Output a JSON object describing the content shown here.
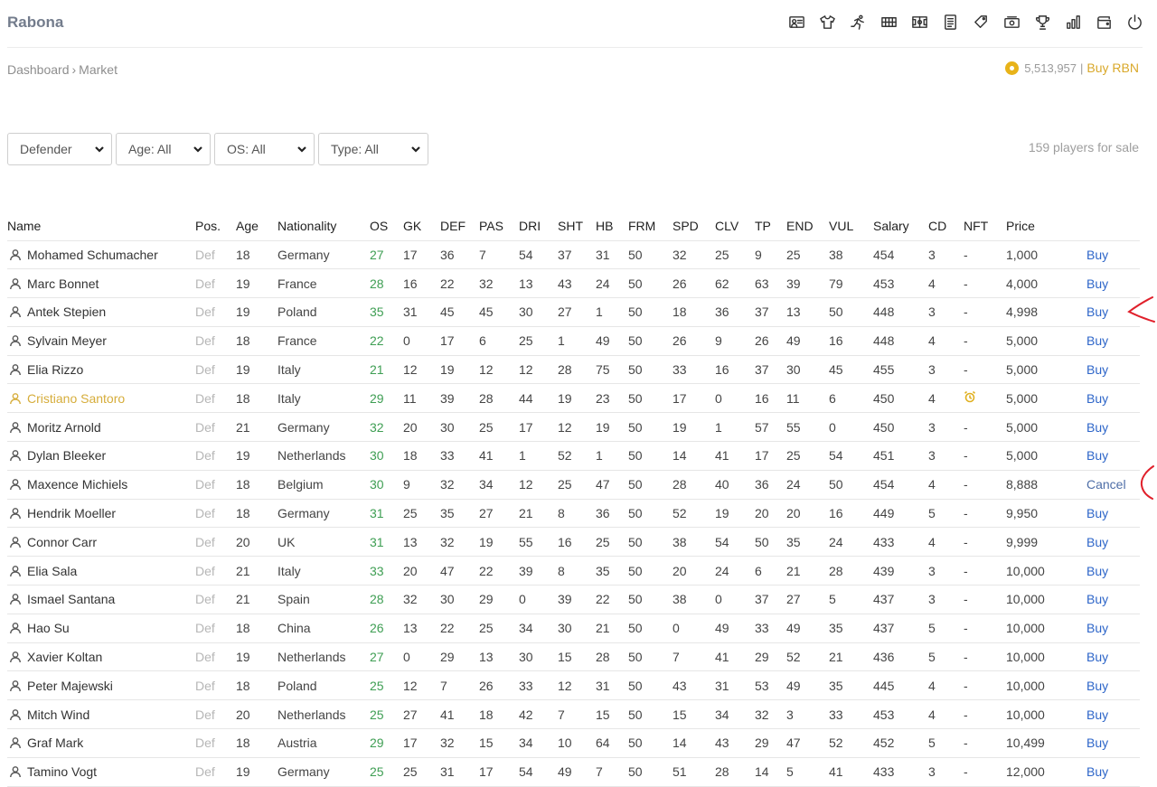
{
  "app": {
    "brand": "Rabona"
  },
  "nav": {
    "icons": [
      "card-icon",
      "shirt-icon",
      "runner-icon",
      "grid-icon",
      "field-icon",
      "document-icon",
      "tag-icon",
      "money-icon",
      "trophy-icon",
      "bar-chart-icon",
      "wallet-icon",
      "power-icon"
    ]
  },
  "breadcrumb": {
    "home": "Dashboard",
    "separator": "›",
    "current": "Market"
  },
  "balance": {
    "amount": "5,513,957",
    "separator": "|",
    "buy_label": "Buy RBN"
  },
  "filters": {
    "position": "Defender",
    "age": "Age: All",
    "os": "OS: All",
    "type": "Type: All"
  },
  "players_for_sale": "159 players for sale",
  "table": {
    "headers": [
      "Name",
      "Pos.",
      "Age",
      "Nationality",
      "OS",
      "GK",
      "DEF",
      "PAS",
      "DRI",
      "SHT",
      "HB",
      "FRM",
      "SPD",
      "CLV",
      "TP",
      "END",
      "VUL",
      "Salary",
      "CD",
      "NFT",
      "Price",
      ""
    ],
    "rows": [
      [
        "Mohamed Schumacher",
        "Def",
        "18",
        "Germany",
        "27",
        "17",
        "36",
        "7",
        "54",
        "37",
        "31",
        "50",
        "32",
        "25",
        "9",
        "25",
        "38",
        "454",
        "3",
        "-",
        "1,000",
        "Buy"
      ],
      [
        "Marc Bonnet",
        "Def",
        "19",
        "France",
        "28",
        "16",
        "22",
        "32",
        "13",
        "43",
        "24",
        "50",
        "26",
        "62",
        "63",
        "39",
        "79",
        "453",
        "4",
        "-",
        "4,000",
        "Buy"
      ],
      [
        "Antek Stepien",
        "Def",
        "19",
        "Poland",
        "35",
        "31",
        "45",
        "45",
        "30",
        "27",
        "1",
        "50",
        "18",
        "36",
        "37",
        "13",
        "50",
        "448",
        "3",
        "-",
        "4,998",
        "Buy"
      ],
      [
        "Sylvain Meyer",
        "Def",
        "18",
        "France",
        "22",
        "0",
        "17",
        "6",
        "25",
        "1",
        "49",
        "50",
        "26",
        "9",
        "26",
        "49",
        "16",
        "448",
        "4",
        "-",
        "5,000",
        "Buy"
      ],
      [
        "Elia Rizzo",
        "Def",
        "19",
        "Italy",
        "21",
        "12",
        "19",
        "12",
        "12",
        "28",
        "75",
        "50",
        "33",
        "16",
        "37",
        "30",
        "45",
        "455",
        "3",
        "-",
        "5,000",
        "Buy"
      ],
      [
        "Cristiano Santoro",
        "Def",
        "18",
        "Italy",
        "29",
        "11",
        "39",
        "28",
        "44",
        "19",
        "23",
        "50",
        "17",
        "0",
        "16",
        "11",
        "6",
        "450",
        "4",
        "",
        "5,000",
        "Buy"
      ],
      [
        "Moritz Arnold",
        "Def",
        "21",
        "Germany",
        "32",
        "20",
        "30",
        "25",
        "17",
        "12",
        "19",
        "50",
        "19",
        "1",
        "57",
        "55",
        "0",
        "450",
        "3",
        "-",
        "5,000",
        "Buy"
      ],
      [
        "Dylan Bleeker",
        "Def",
        "19",
        "Netherlands",
        "30",
        "18",
        "33",
        "41",
        "1",
        "52",
        "1",
        "50",
        "14",
        "41",
        "17",
        "25",
        "54",
        "451",
        "3",
        "-",
        "5,000",
        "Buy"
      ],
      [
        "Maxence Michiels",
        "Def",
        "18",
        "Belgium",
        "30",
        "9",
        "32",
        "34",
        "12",
        "25",
        "47",
        "50",
        "28",
        "40",
        "36",
        "24",
        "50",
        "454",
        "4",
        "-",
        "8,888",
        "Cancel"
      ],
      [
        "Hendrik Moeller",
        "Def",
        "18",
        "Germany",
        "31",
        "25",
        "35",
        "27",
        "21",
        "8",
        "36",
        "50",
        "52",
        "19",
        "20",
        "20",
        "16",
        "449",
        "5",
        "-",
        "9,950",
        "Buy"
      ],
      [
        "Connor Carr",
        "Def",
        "20",
        "UK",
        "31",
        "13",
        "32",
        "19",
        "55",
        "16",
        "25",
        "50",
        "38",
        "54",
        "50",
        "35",
        "24",
        "433",
        "4",
        "-",
        "9,999",
        "Buy"
      ],
      [
        "Elia Sala",
        "Def",
        "21",
        "Italy",
        "33",
        "20",
        "47",
        "22",
        "39",
        "8",
        "35",
        "50",
        "20",
        "24",
        "6",
        "21",
        "28",
        "439",
        "3",
        "-",
        "10,000",
        "Buy"
      ],
      [
        "Ismael Santana",
        "Def",
        "21",
        "Spain",
        "28",
        "32",
        "30",
        "29",
        "0",
        "39",
        "22",
        "50",
        "38",
        "0",
        "37",
        "27",
        "5",
        "437",
        "3",
        "-",
        "10,000",
        "Buy"
      ],
      [
        "Hao Su",
        "Def",
        "18",
        "China",
        "26",
        "13",
        "22",
        "25",
        "34",
        "30",
        "21",
        "50",
        "0",
        "49",
        "33",
        "49",
        "35",
        "437",
        "5",
        "-",
        "10,000",
        "Buy"
      ],
      [
        "Xavier Koltan",
        "Def",
        "19",
        "Netherlands",
        "27",
        "0",
        "29",
        "13",
        "30",
        "15",
        "28",
        "50",
        "7",
        "41",
        "29",
        "52",
        "21",
        "436",
        "5",
        "-",
        "10,000",
        "Buy"
      ],
      [
        "Peter Majewski",
        "Def",
        "18",
        "Poland",
        "25",
        "12",
        "7",
        "26",
        "33",
        "12",
        "31",
        "50",
        "43",
        "31",
        "53",
        "49",
        "35",
        "445",
        "4",
        "-",
        "10,000",
        "Buy"
      ],
      [
        "Mitch Wind",
        "Def",
        "20",
        "Netherlands",
        "25",
        "27",
        "41",
        "18",
        "42",
        "7",
        "15",
        "50",
        "15",
        "34",
        "32",
        "3",
        "33",
        "453",
        "4",
        "-",
        "10,000",
        "Buy"
      ],
      [
        "Graf Mark",
        "Def",
        "18",
        "Austria",
        "29",
        "17",
        "32",
        "15",
        "34",
        "10",
        "64",
        "50",
        "14",
        "43",
        "29",
        "47",
        "52",
        "452",
        "5",
        "-",
        "10,499",
        "Buy"
      ],
      [
        "Tamino Vogt",
        "Def",
        "19",
        "Germany",
        "25",
        "25",
        "31",
        "17",
        "54",
        "49",
        "7",
        "50",
        "51",
        "28",
        "14",
        "5",
        "41",
        "433",
        "3",
        "-",
        "12,000",
        "Buy"
      ]
    ],
    "gold_row_index": 5
  },
  "colors": {
    "accent": "#2e66c9",
    "gold": "#d6ad3b",
    "os_green": "#3e9e53",
    "annotation": "#e0202b"
  }
}
